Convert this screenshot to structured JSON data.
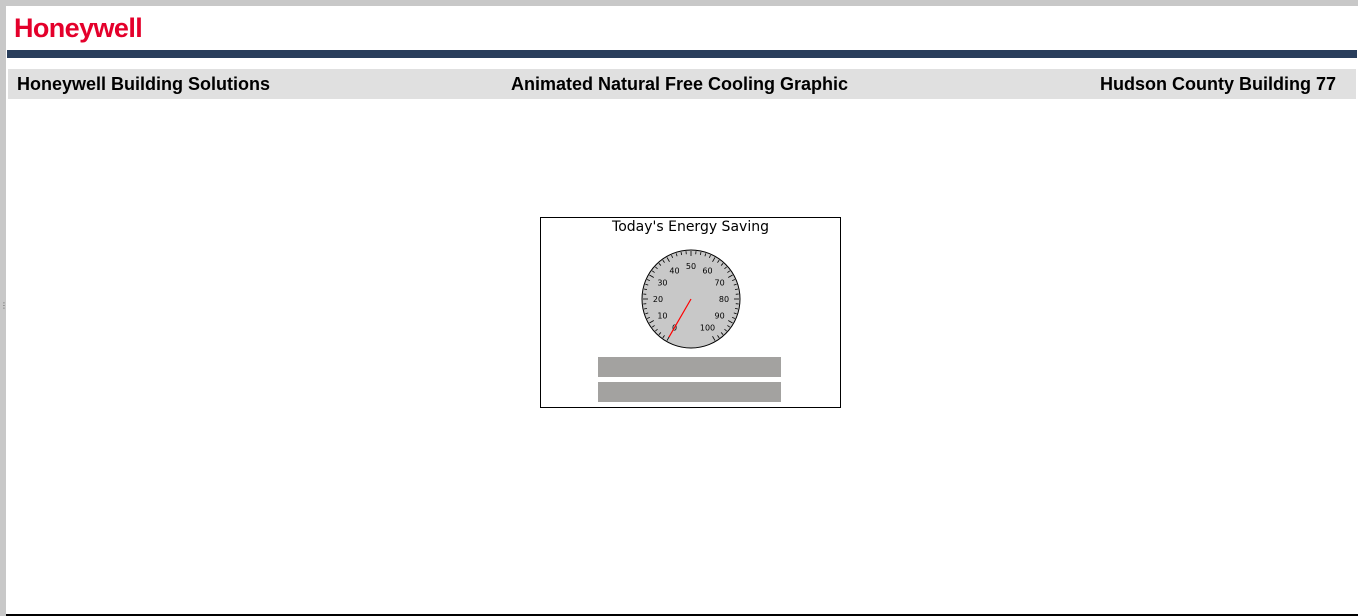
{
  "brand": {
    "logo_text": "Honeywell",
    "logo_color": "#e4002b",
    "bar_color": "#293e5c"
  },
  "header": {
    "left": "Honeywell Building Solutions",
    "center": "Animated Natural Free Cooling Graphic",
    "right": "Hudson County Building 77"
  },
  "energy_panel": {
    "title": "Today's Energy Saving",
    "gauge": {
      "min": 0,
      "max": 100,
      "value": 0,
      "tick_labels": [
        "0",
        "10",
        "20",
        "30",
        "40",
        "50",
        "60",
        "70",
        "80",
        "90",
        "100"
      ],
      "needle_color": "#ff0000",
      "face_color": "#c8c8c8"
    },
    "readout_1": "",
    "readout_2": ""
  }
}
